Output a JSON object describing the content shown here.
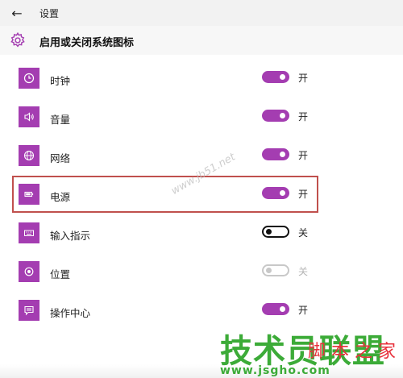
{
  "window": {
    "title": "设置"
  },
  "page": {
    "title": "启用或关闭系统图标"
  },
  "items": [
    {
      "label": "时钟",
      "state": "开",
      "toggle": "on",
      "icon": "clock-icon"
    },
    {
      "label": "音量",
      "state": "开",
      "toggle": "on",
      "icon": "volume-icon"
    },
    {
      "label": "网络",
      "state": "开",
      "toggle": "on",
      "icon": "globe-icon"
    },
    {
      "label": "电源",
      "state": "开",
      "toggle": "on",
      "icon": "battery-icon"
    },
    {
      "label": "输入指示",
      "state": "关",
      "toggle": "off",
      "icon": "keyboard-icon"
    },
    {
      "label": "位置",
      "state": "关",
      "toggle": "disabled",
      "icon": "location-icon"
    },
    {
      "label": "操作中心",
      "state": "开",
      "toggle": "on",
      "icon": "message-icon"
    }
  ],
  "watermark": {
    "mid": "www.jb51.net",
    "main": "技术员联盟",
    "side": "脚 本 之 家",
    "url": "www.jsgho.com"
  },
  "colors": {
    "accent": "#a43db1",
    "highlight": "#c0504d",
    "watermark_green": "#3cab38",
    "watermark_red": "#e8303b"
  }
}
